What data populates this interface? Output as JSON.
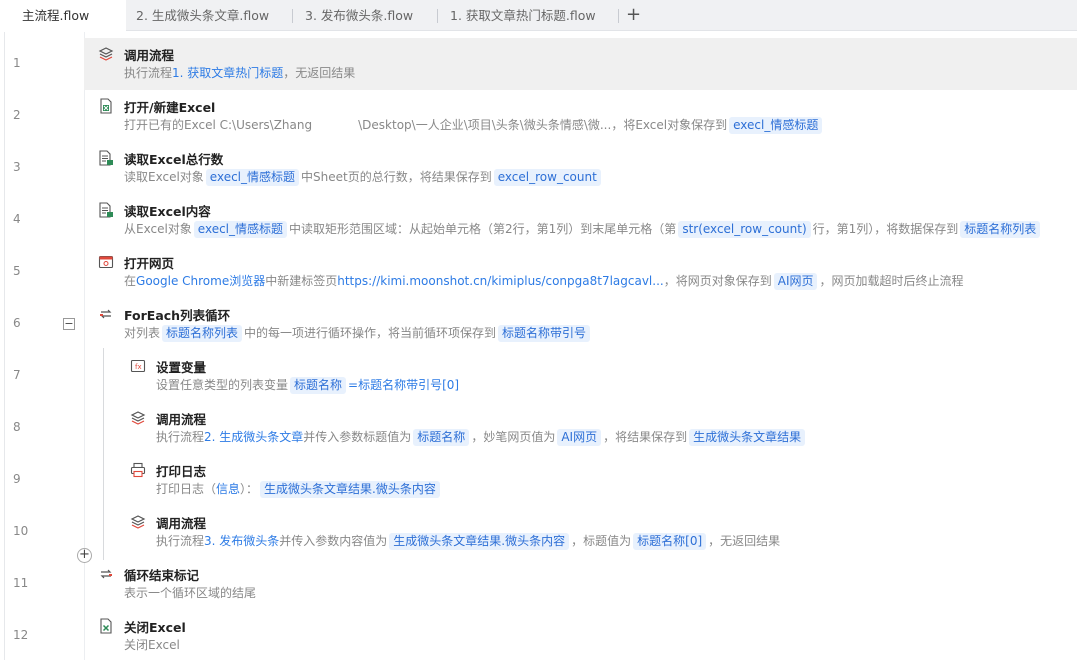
{
  "tabs": [
    {
      "label": "主流程.flow",
      "active": true
    },
    {
      "label": "2. 生成微头条文章.flow",
      "active": false
    },
    {
      "label": "3. 发布微头条.flow",
      "active": false
    },
    {
      "label": "1. 获取文章热门标题.flow",
      "active": false
    }
  ],
  "add_tab_label": "+",
  "collapse_label": "−",
  "add_step_label": "+",
  "steps": [
    {
      "num": "1",
      "icon": "call-flow-icon",
      "title": "调用流程",
      "desc": [
        {
          "t": "执行流程"
        },
        {
          "t": "1. 获取文章热门标题",
          "k": "link"
        },
        {
          "t": "，无返回结果"
        }
      ]
    },
    {
      "num": "2",
      "icon": "excel-open-icon",
      "title": "打开/新建Excel",
      "desc": [
        {
          "t": "打开已有的Excel C:\\Users\\Zhang"
        },
        {
          "t": "\\Desktop\\一人企业\\项目\\头条\\微头条情感\\微...",
          "pad": true
        },
        {
          "t": "，将Excel对象保存到"
        },
        {
          "t": "execl_情感标题",
          "k": "var"
        }
      ]
    },
    {
      "num": "3",
      "icon": "excel-read-icon",
      "title": "读取Excel总行数",
      "desc": [
        {
          "t": "读取Excel对象"
        },
        {
          "t": "execl_情感标题",
          "k": "var"
        },
        {
          "t": "中Sheet页的总行数，将结果保存到"
        },
        {
          "t": "excel_row_count",
          "k": "var"
        }
      ]
    },
    {
      "num": "4",
      "icon": "excel-content-icon",
      "title": "读取Excel内容",
      "desc": [
        {
          "t": "从Excel对象"
        },
        {
          "t": "execl_情感标题",
          "k": "var"
        },
        {
          "t": "中读取矩形范围区域：从起始单元格（第2行，第1列）到末尾单元格（第"
        },
        {
          "t": "str(excel_row_count)",
          "k": "var"
        },
        {
          "t": "行，第1列），将数据保存到"
        },
        {
          "t": "标题名称列表",
          "k": "var"
        }
      ]
    },
    {
      "num": "5",
      "icon": "browser-icon",
      "title": "打开网页",
      "desc": [
        {
          "t": "在"
        },
        {
          "t": "Google Chrome浏览器",
          "k": "link"
        },
        {
          "t": "中新建标签页"
        },
        {
          "t": "https://kimi.moonshot.cn/kimiplus/conpga8t7lagcavl...",
          "k": "link"
        },
        {
          "t": "，将网页对象保存到"
        },
        {
          "t": "AI网页",
          "k": "var"
        },
        {
          "t": "，网页加载超时后终止流程"
        }
      ]
    },
    {
      "num": "6",
      "icon": "loop-icon",
      "title": "ForEach列表循环",
      "desc": [
        {
          "t": "对列表"
        },
        {
          "t": "标题名称列表",
          "k": "var"
        },
        {
          "t": "中的每一项进行循环操作，将当前循环项保存到"
        },
        {
          "t": "标题名称带引号",
          "k": "var"
        }
      ]
    },
    {
      "num": "7",
      "icon": "set-variable-icon",
      "title": "设置变量",
      "desc": [
        {
          "t": "设置任意类型的列表变量"
        },
        {
          "t": "标题名称",
          "k": "var"
        },
        {
          "t": "=标题名称带引号[0]",
          "k": "link"
        }
      ]
    },
    {
      "num": "8",
      "icon": "call-flow-icon",
      "title": "调用流程",
      "desc": [
        {
          "t": "执行流程"
        },
        {
          "t": "2. 生成微头条文章",
          "k": "link"
        },
        {
          "t": "并传入参数标题值为"
        },
        {
          "t": "标题名称",
          "k": "var"
        },
        {
          "t": "，妙笔网页值为"
        },
        {
          "t": "AI网页",
          "k": "var"
        },
        {
          "t": "，将结果保存到"
        },
        {
          "t": "生成微头条文章结果",
          "k": "var"
        }
      ]
    },
    {
      "num": "9",
      "icon": "print-log-icon",
      "title": "打印日志",
      "desc": [
        {
          "t": "打印日志（"
        },
        {
          "t": "信息",
          "k": "link"
        },
        {
          "t": "）："
        },
        {
          "t": "生成微头条文章结果.微头条内容",
          "k": "var"
        }
      ]
    },
    {
      "num": "10",
      "icon": "call-flow-icon",
      "title": "调用流程",
      "desc": [
        {
          "t": "执行流程"
        },
        {
          "t": "3. 发布微头条",
          "k": "link"
        },
        {
          "t": "并传入参数内容值为"
        },
        {
          "t": "生成微头条文章结果.微头条内容",
          "k": "var"
        },
        {
          "t": "，标题值为"
        },
        {
          "t": "标题名称[0]",
          "k": "var"
        },
        {
          "t": "，无返回结果"
        }
      ]
    },
    {
      "num": "11",
      "icon": "loop-end-icon",
      "title": "循环结束标记",
      "desc": [
        {
          "t": "表示一个循环区域的结尾"
        }
      ]
    },
    {
      "num": "12",
      "icon": "excel-close-icon",
      "title": "关闭Excel",
      "desc": [
        {
          "t": "关闭Excel"
        }
      ]
    }
  ]
}
